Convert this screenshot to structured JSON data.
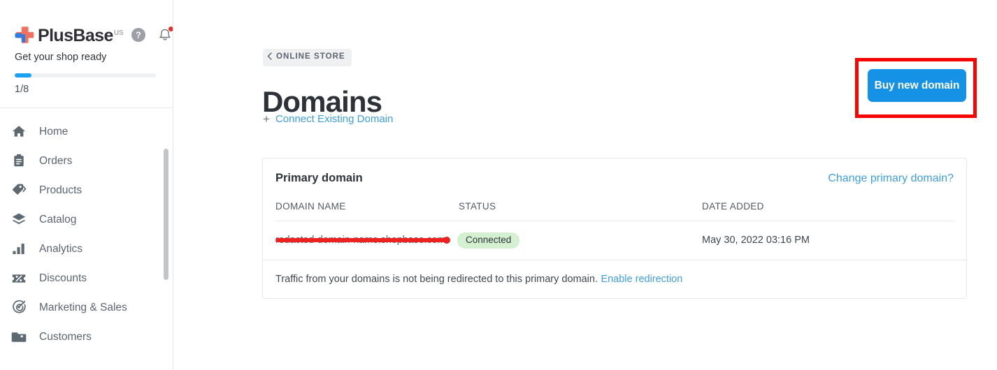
{
  "brand": {
    "logo_icon": "pluscross-logo-icon",
    "wordmark": "PlusBase",
    "region_superscript": "US",
    "logo_color_top": "#f1705f",
    "logo_color_bottom": "#2e7de0",
    "help_icon": "question-circle-icon",
    "notifications_icon": "bell-icon",
    "notification_dot_color": "#ee2b2b"
  },
  "onboarding": {
    "title": "Get your shop ready",
    "progress_label": "1/8",
    "progress_percent": 12,
    "progress_color": "#19a2f0"
  },
  "sidebar": {
    "items": [
      {
        "label": "Home",
        "icon": "home-icon"
      },
      {
        "label": "Orders",
        "icon": "clipboard-icon"
      },
      {
        "label": "Products",
        "icon": "tag-icon"
      },
      {
        "label": "Catalog",
        "icon": "layers-icon"
      },
      {
        "label": "Analytics",
        "icon": "bar-chart-icon"
      },
      {
        "label": "Discounts",
        "icon": "discount-ticket-icon"
      },
      {
        "label": "Marketing & Sales",
        "icon": "target-icon"
      },
      {
        "label": "Customers",
        "icon": "customers-folder-icon"
      }
    ]
  },
  "header": {
    "breadcrumb_label": "ONLINE STORE",
    "breadcrumb_icon": "chevron-left-icon",
    "page_title": "Domains",
    "connect_existing_label": "Connect Existing Domain",
    "connect_existing_icon": "plus-icon",
    "buy_new_domain_label": "Buy new domain",
    "buy_button_color": "#1592e6",
    "annotation_color": "#f60505"
  },
  "card": {
    "title": "Primary domain",
    "change_primary_link": "Change primary domain?",
    "columns": [
      "DOMAIN NAME",
      "STATUS",
      "DATE ADDED"
    ],
    "rows": [
      {
        "domain_name": "redacted-domain-name.shopbase.com",
        "domain_redacted": true,
        "status": "Connected",
        "status_bg": "#d5f0d0",
        "date_added": "May 30, 2022 03:16 PM"
      }
    ],
    "footer_text": "Traffic from your domains is not being redirected to this primary domain.",
    "footer_link": "Enable redirection"
  }
}
